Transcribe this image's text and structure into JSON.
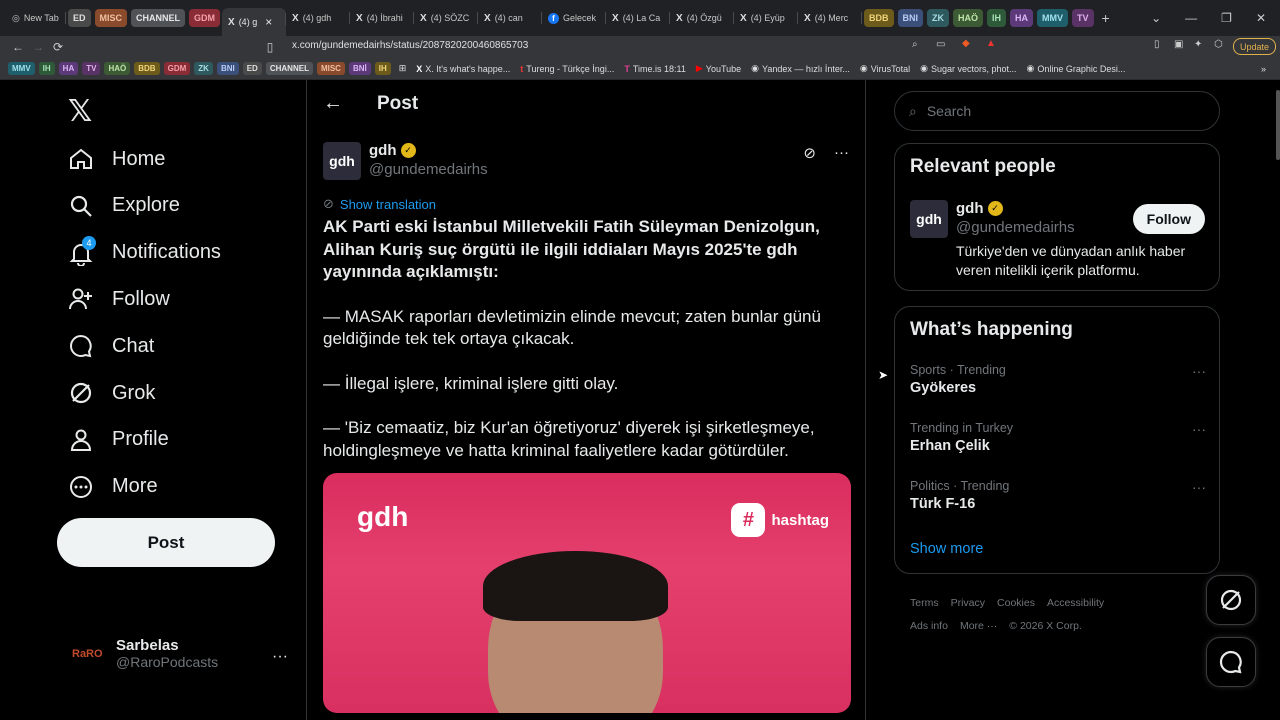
{
  "browser": {
    "tabs": [
      {
        "label": "New Tab",
        "kind": "tab"
      },
      {
        "label": "ED",
        "kind": "group",
        "bg": "#4a4a4a",
        "fg": "#e0e0e0"
      },
      {
        "label": "MISC",
        "kind": "group",
        "bg": "#8a4a2c",
        "fg": "#f0c0a0"
      },
      {
        "label": "CHANNEL",
        "kind": "group",
        "bg": "#4f5358",
        "fg": "#e6e6e6"
      },
      {
        "label": "GDM",
        "kind": "group",
        "bg": "#8a2c35",
        "fg": "#f2a0a8"
      },
      {
        "label": "(4) g",
        "kind": "x-active"
      },
      {
        "label": "(4) gdh",
        "kind": "x"
      },
      {
        "label": "(4) İbrahi",
        "kind": "x"
      },
      {
        "label": "(4) SÖZC",
        "kind": "x"
      },
      {
        "label": "(4) can",
        "kind": "x"
      },
      {
        "label": "Gelecek",
        "kind": "fb"
      },
      {
        "label": "(4) La Ca",
        "kind": "x"
      },
      {
        "label": "(4) Özgü",
        "kind": "x"
      },
      {
        "label": "(4) Eyüp",
        "kind": "x"
      },
      {
        "label": "(4) Merc",
        "kind": "x"
      },
      {
        "label": "BDB",
        "kind": "group",
        "bg": "#6d5b1c",
        "fg": "#f1d57a"
      },
      {
        "label": "BNI",
        "kind": "group",
        "bg": "#3a4f7a",
        "fg": "#b8cdf5"
      },
      {
        "label": "ZK",
        "kind": "group",
        "bg": "#2e5a5f",
        "fg": "#a6dde2"
      },
      {
        "label": "HAÖ",
        "kind": "group",
        "bg": "#3c5b34",
        "fg": "#bfe3a9"
      },
      {
        "label": "IH",
        "kind": "group",
        "bg": "#2f5a3a",
        "fg": "#a6e0b4"
      },
      {
        "label": "HA",
        "kind": "group",
        "bg": "#5c3a7a",
        "fg": "#dcb6f5"
      },
      {
        "label": "MMV",
        "kind": "group",
        "bg": "#1f5f6b",
        "fg": "#9fe2ee"
      },
      {
        "label": "TV",
        "kind": "group",
        "bg": "#5a3366",
        "fg": "#e2b0ee"
      }
    ],
    "url": "x.com/gundemedairhs/status/2087820200460865703",
    "update_label": "Update",
    "bookmarks_groups": [
      {
        "label": "MMV",
        "bg": "#1f5f6b",
        "fg": "#9fe2ee"
      },
      {
        "label": "IH",
        "bg": "#2f5a3a",
        "fg": "#a6e0b4"
      },
      {
        "label": "HA",
        "bg": "#5c3a7a",
        "fg": "#dcb6f5"
      },
      {
        "label": "TV",
        "bg": "#5a3366",
        "fg": "#e2b0ee"
      },
      {
        "label": "HAÖ",
        "bg": "#3c5b34",
        "fg": "#bfe3a9"
      },
      {
        "label": "BDB",
        "bg": "#6d5b1c",
        "fg": "#f1d57a"
      },
      {
        "label": "GDM",
        "bg": "#8a2c35",
        "fg": "#f2a0a8"
      },
      {
        "label": "ZK",
        "bg": "#2e5a5f",
        "fg": "#a6dde2"
      },
      {
        "label": "BNI",
        "bg": "#3a4f7a",
        "fg": "#b8cdf5"
      },
      {
        "label": "ED",
        "bg": "#4a4a4a",
        "fg": "#e0e0e0"
      },
      {
        "label": "CHANNEL",
        "bg": "#4f5358",
        "fg": "#e6e6e6"
      },
      {
        "label": "MISC",
        "bg": "#8a4a2c",
        "fg": "#f0c0a0"
      },
      {
        "label": "BNİ",
        "bg": "#5c3a7a",
        "fg": "#dcb6f5"
      },
      {
        "label": "IH",
        "bg": "#6d5b1c",
        "fg": "#f1d57a"
      }
    ],
    "bookmarks": [
      {
        "label": "X. It's what's happe...",
        "icon": "x-icon"
      },
      {
        "label": "Tureng - Türkçe İngi...",
        "icon": "tureng-icon"
      },
      {
        "label": "Time.is 18:11",
        "icon": "time-icon"
      },
      {
        "label": "YouTube",
        "icon": "youtube-icon"
      },
      {
        "label": "Yandex — hızlı İnter...",
        "icon": "yandex-icon"
      },
      {
        "label": "VirusTotal",
        "icon": "virustotal-icon"
      },
      {
        "label": "Sugar vectors, phot...",
        "icon": "sugar-icon"
      },
      {
        "label": "Online Graphic Desi...",
        "icon": "canva-icon"
      }
    ]
  },
  "nav": {
    "items": [
      {
        "label": "Home",
        "icon": "home-icon"
      },
      {
        "label": "Explore",
        "icon": "search-icon"
      },
      {
        "label": "Notifications",
        "icon": "bell-icon",
        "badge": "4"
      },
      {
        "label": "Follow",
        "icon": "follow-icon"
      },
      {
        "label": "Chat",
        "icon": "chat-icon"
      },
      {
        "label": "Grok",
        "icon": "grok-icon"
      },
      {
        "label": "Profile",
        "icon": "profile-icon"
      },
      {
        "label": "More",
        "icon": "more-icon"
      }
    ],
    "post_label": "Post",
    "account": {
      "name": "Sarbelas",
      "handle": "@RaroPodcasts",
      "avatar_text": "RaRO"
    }
  },
  "post": {
    "header_title": "Post",
    "author": {
      "name": "gdh",
      "handle": "@gundemedairhs",
      "avatar_text": "gdh"
    },
    "show_translation": "Show translation",
    "lead": "AK Parti eski İstanbul Milletvekili Fatih Süleyman Denizolgun, Alihan Kuriş suç örgütü ile ilgili iddiaları Mayıs 2025'te gdh yayınında açıklamıştı:",
    "paragraphs": [
      "— MASAK raporları devletimizin elinde mevcut; zaten bunlar günü geldiğinde tek tek ortaya çıkacak.",
      "— İllegal işlere, kriminal işlere gitti olay.",
      "— 'Biz cemaatiz, biz Kur'an öğretiyoruz' diyerek işi şirketleşmeye, holdingleşmeye ve hatta kriminal faaliyetlere kadar götürdüler."
    ],
    "media": {
      "logo": "gdh",
      "hashtag_symbol": "#",
      "hashtag_label": "hashtag"
    }
  },
  "sidebar": {
    "search_placeholder": "Search",
    "relevant": {
      "title": "Relevant people",
      "name": "gdh",
      "handle": "@gundemedairhs",
      "avatar_text": "gdh",
      "bio": "Türkiye'den ve dünyadan anlık haber veren nitelikli içerik platformu.",
      "follow_label": "Follow"
    },
    "happening": {
      "title": "What’s happening",
      "trends": [
        {
          "meta": "Sports · Trending",
          "name": "Gyökeres"
        },
        {
          "meta": "Trending in Turkey",
          "name": "Erhan Çelik"
        },
        {
          "meta": "Politics · Trending",
          "name": "Türk F-16"
        }
      ],
      "show_more": "Show more"
    },
    "footer": [
      "Terms",
      "Privacy",
      "Cookies",
      "Accessibility",
      "Ads info",
      "More ···",
      "© 2026 X Corp."
    ]
  },
  "colors": {
    "accent": "#1d9bf0",
    "verified": "#e2b719",
    "media_bg": "#d92d5e"
  }
}
